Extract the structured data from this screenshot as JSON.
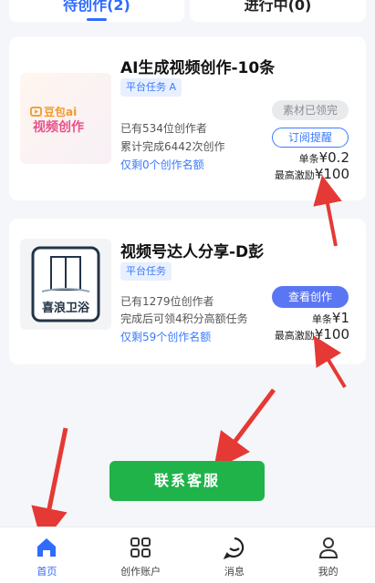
{
  "tabs": [
    {
      "label": "待创作(2)"
    },
    {
      "label": "进行中(0)"
    }
  ],
  "tasks": [
    {
      "title": "AI生成视频创作-10条",
      "tag": "平台任务 A",
      "creators": "已有534位创作者",
      "stats": "累计完成6442次创作",
      "remaining": "仅剩0个创作名额",
      "status_button": "素材已领完",
      "action_button": "订阅提醒",
      "unit_label": "单条",
      "unit_price": "¥0.2",
      "max_label": "最高激励",
      "max_price": "¥100",
      "logo_text_1": "豆包ai",
      "logo_text_2": "视频创作"
    },
    {
      "title": "视频号达人分享-D彭",
      "tag": "平台任务",
      "creators": "已有1279位创作者",
      "stats": "完成后可领4积分高额任务",
      "remaining": "仅剩59个创作名额",
      "action_button": "查看创作",
      "unit_label": "单条",
      "unit_price": "¥1",
      "max_label": "最高激励",
      "max_price": "¥100",
      "logo_text": "喜浪卫浴"
    }
  ],
  "contact_button": "联系客服",
  "bottom_nav": [
    {
      "label": "首页",
      "icon": "home-icon"
    },
    {
      "label": "创作账户",
      "icon": "grid-icon"
    },
    {
      "label": "消息",
      "icon": "chat-icon"
    },
    {
      "label": "我的",
      "icon": "user-icon"
    }
  ],
  "colors": {
    "accent": "#2f6bff",
    "green": "#1fb34a",
    "arrow": "#e53935"
  }
}
